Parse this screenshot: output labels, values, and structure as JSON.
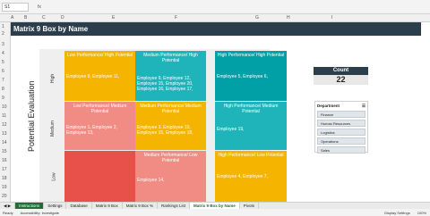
{
  "formula_bar": {
    "name_box": "S1",
    "fx": "fx"
  },
  "columns": [
    "A",
    "B",
    "C",
    "D",
    "E",
    "F",
    "G",
    "H",
    "I"
  ],
  "rows": [
    "1",
    "2",
    "3",
    "4",
    "5",
    "6",
    "7",
    "8",
    "9",
    "10",
    "11",
    "12",
    "13",
    "14",
    "15",
    "16",
    "17",
    "18",
    "19",
    "20",
    "21"
  ],
  "title": "Matrix 9 Box by Name",
  "y_axis_label": "Potential Evaluation",
  "row_labels": {
    "high": "High",
    "medium": "Medium",
    "low": "Low"
  },
  "cells": [
    {
      "header": "Low Performance/ High Potential",
      "body": "Employee 8, Employee 11,",
      "color": "#f5b400"
    },
    {
      "header": "Medium Performance/ High Potential",
      "body": "Employee 9, Employee 12, Employee 15, Employee 20, Employee 16, Employee 17,",
      "color": "#1fb4ba"
    },
    {
      "header": "High Performance/ High Potential",
      "body": "Employee 5, Employee 6,",
      "color": "#00a0a6"
    },
    {
      "header": "Low Performance/ Medium Potential",
      "body": "Employee 1, Employee 2, Employee 13,",
      "color": "#f08c84"
    },
    {
      "header": "Medium Performance/ Medium Potential",
      "body": "Employee 3, Employee 10, Employee 15, Employee 18,",
      "color": "#f5b400"
    },
    {
      "header": "High Performance/ Medium Potential",
      "body": "Employee 19,",
      "color": "#1fb4ba"
    },
    {
      "header": "Medium Performance/ Low Potential",
      "body": "Employee 14,",
      "color": "#f08c84"
    },
    {
      "header": "High Performance/ Low Potential",
      "body": "Employee 4, Employee 7,",
      "color": "#f5b400"
    }
  ],
  "count": {
    "label": "Count",
    "value": "22"
  },
  "slicer": {
    "title": "Department",
    "items": [
      "Finance",
      "Human Resources",
      "Logistics",
      "Operations",
      "Sales"
    ]
  },
  "tabs": [
    "Instructions",
    "Settings",
    "Database",
    "Matrix 9 Box",
    "Matrix 9 Box %",
    "Rankings List",
    "Matrix 9 Box by Name",
    "Pivots"
  ],
  "status": {
    "ready": "Ready",
    "accessibility": "Accessibility: Investigate",
    "display": "Display Settings",
    "zoom": "100%"
  }
}
